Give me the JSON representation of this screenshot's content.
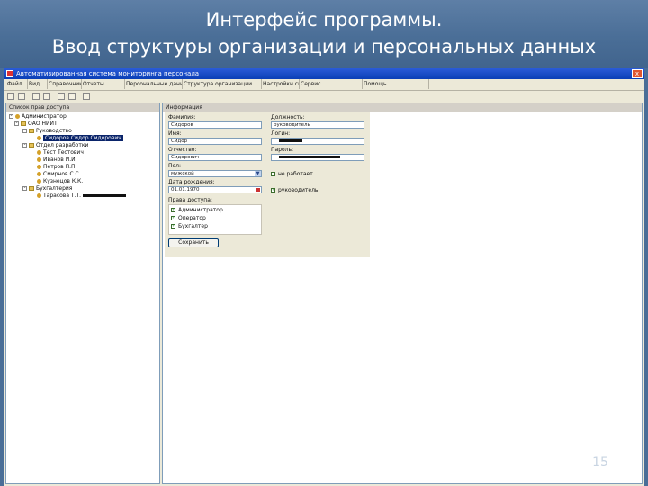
{
  "slide": {
    "title_line1": "Интерфейс программы.",
    "title_line2": "Ввод структуры организации и персональных данных",
    "page_number": "15"
  },
  "window": {
    "title": "Автоматизированная система мониторинга персонала",
    "close_label": "x"
  },
  "menu": {
    "items": [
      "Файл",
      "Вид",
      "Справочники",
      "Отчеты",
      "Персональные данные",
      "Структура организации",
      "Настройки системы",
      "Сервис",
      "Помощь"
    ]
  },
  "tree": {
    "header": "Список прав доступа",
    "nodes": [
      {
        "label": "Администратор",
        "expander": "-"
      },
      {
        "label": "ОАО НИИТ",
        "expander": "-"
      },
      {
        "label": "Руководство",
        "expander": "-"
      },
      {
        "label": "Сидоров Сидор Сидорович"
      },
      {
        "label": "Отдел разработки",
        "expander": "-"
      },
      {
        "label": "Тест Тестович"
      },
      {
        "label": "Иванов И.И."
      },
      {
        "label": "Петров П.П."
      },
      {
        "label": "Смирнов С.С."
      },
      {
        "label": "Кузнецов К.К."
      },
      {
        "label": "Бухгалтерия",
        "expander": "-"
      },
      {
        "label": "Тарасова Т.Т."
      }
    ]
  },
  "info": {
    "header": "Информация",
    "surname_label": "Фамилия:",
    "surname_value": "Сидоров",
    "name_label": "Имя:",
    "name_value": "Сидор",
    "patronymic_label": "Отчество:",
    "patronymic_value": "Сидорович",
    "gender_label": "Пол:",
    "gender_value": "мужской",
    "birthdate_label": "Дата рождения:",
    "birthdate_value": "01.01.1970",
    "position_label": "Должность:",
    "position_value": "руководитель",
    "login_label": "Логин:",
    "password_label": "Пароль:",
    "permissions_label": "Права доступа:",
    "permissions": [
      "Администратор",
      "Оператор",
      "Бухгалтер"
    ],
    "option1_label": "не работает",
    "option2_label": "руководитель",
    "save_label": "Сохранить"
  },
  "colors": {
    "header_bg": "#4a6e97",
    "titlebar": "#0a3fb6",
    "selection": "#0a246a"
  }
}
